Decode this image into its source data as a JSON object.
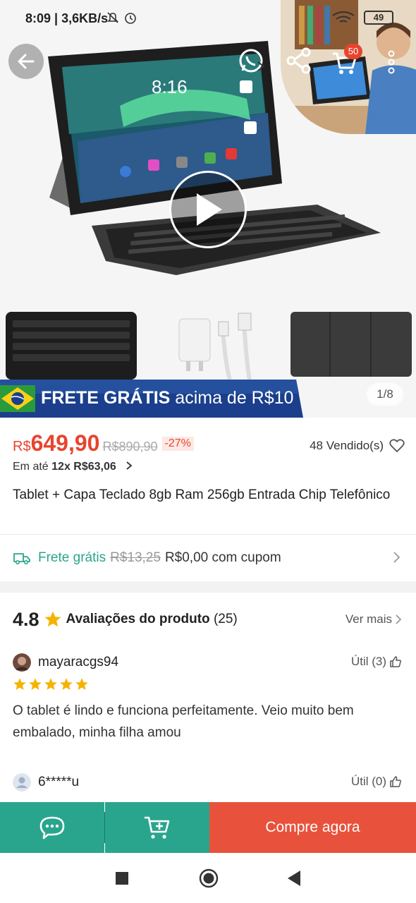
{
  "status_bar": {
    "time_speed": "8:09 | 3,6KB/s",
    "battery_label": "49"
  },
  "hero": {
    "cart_count": "50",
    "screen_clock": "8:16",
    "image_counter": "1/8",
    "banner": {
      "bold": "FRETE GRÁTIS",
      "rest": " acima de R$10"
    }
  },
  "price": {
    "currency": "R$",
    "value": "649,90",
    "old": "R$890,90",
    "discount": "-27%",
    "sold": "48 Vendido(s)",
    "installments_prefix": "Em até ",
    "installments": "12x R$63,06"
  },
  "product": {
    "title": "Tablet + Capa Teclado 8gb Ram 256gb Entrada Chip Telefônico"
  },
  "shipping": {
    "label": "Frete grátis",
    "old": "R$13,25",
    "new": "R$0,00 com cupom"
  },
  "reviews": {
    "score": "4.8",
    "label": "Avaliações do produto",
    "count": "(25)",
    "more": "Ver mais",
    "items": [
      {
        "user": "mayaracgs94",
        "useful": "Útil (3)",
        "stars": 5,
        "text": "O tablet é lindo e funciona perfeitamente. Veio muito bem embalado,  minha filha amou"
      },
      {
        "user": "6*****u",
        "useful": "Útil (0)"
      }
    ]
  },
  "actions": {
    "buy": "Compre agora"
  },
  "colors": {
    "accent_green": "#2aa58d",
    "accent_red": "#e8442e",
    "buy_button": "#e8523c",
    "star": "#f5b301"
  }
}
